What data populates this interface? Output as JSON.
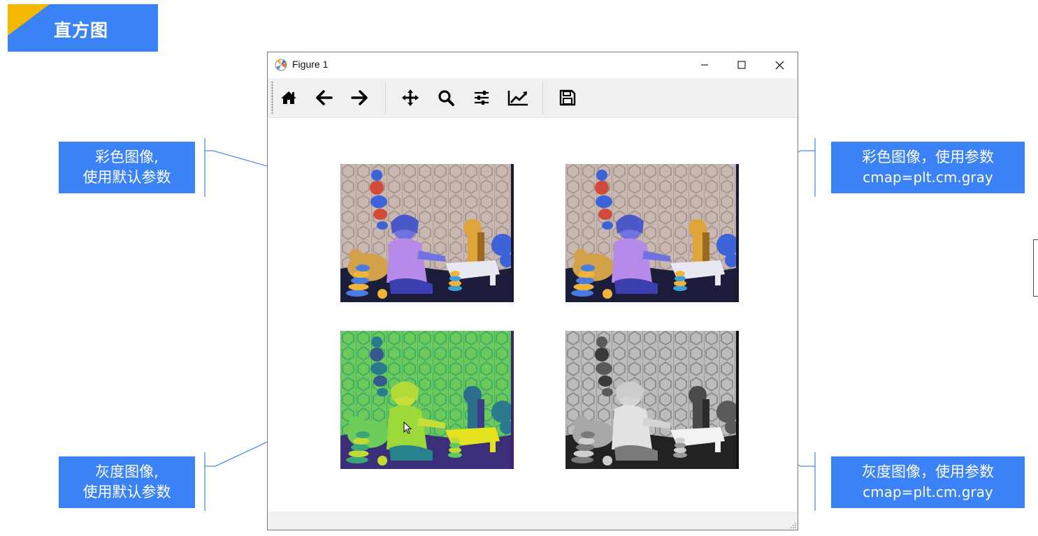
{
  "slide": {
    "title": "直方图"
  },
  "window": {
    "title": "Figure 1",
    "icons": {
      "app": "matplotlib-logo-icon",
      "minimize": "minimize-icon",
      "maximize": "maximize-icon",
      "close": "close-icon"
    },
    "toolbar": [
      {
        "name": "home-icon"
      },
      {
        "name": "arrow-left-icon"
      },
      {
        "name": "arrow-right-icon"
      },
      {
        "name": "move-icon"
      },
      {
        "name": "zoom-icon"
      },
      {
        "name": "sliders-icon"
      },
      {
        "name": "chart-line-icon"
      },
      {
        "name": "save-icon"
      }
    ]
  },
  "panels": [
    {
      "name": "color-image-default",
      "colormap": "bgr-swapped"
    },
    {
      "name": "color-image-gray",
      "colormap": "bgr-swapped"
    },
    {
      "name": "gray-image-default",
      "colormap": "viridis"
    },
    {
      "name": "gray-image-gray",
      "colormap": "gray"
    }
  ],
  "callouts": {
    "top_left": {
      "line1": "彩色图像,",
      "line2": "使用默认参数"
    },
    "top_right": {
      "line1": "彩色图像，使用参数",
      "line2": "cmap=plt.cm.gray"
    },
    "bottom_left": {
      "line1": "灰度图像,",
      "line2": "使用默认参数"
    },
    "bottom_right": {
      "line1": "灰度图像，使用参数",
      "line2": "cmap=plt.cm.gray"
    }
  },
  "colors": {
    "accent": "#3b82f6",
    "corner": "#f5b800"
  }
}
